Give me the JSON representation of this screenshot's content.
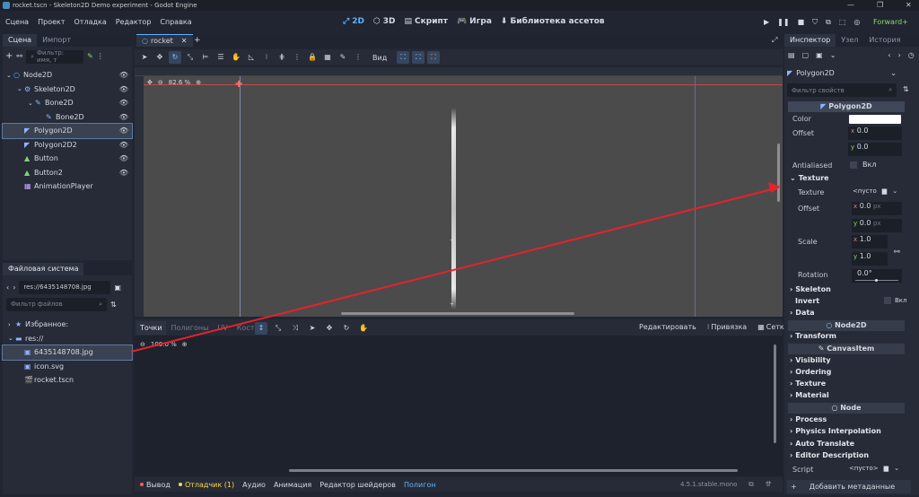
{
  "window": {
    "title": "rocket.tscn - Skeleton2D Demo experiment - Godot Engine",
    "minimize": "—",
    "maximize": "❐",
    "close": "✕"
  },
  "menu": [
    "Сцена",
    "Проект",
    "Отладка",
    "Редактор",
    "Справка"
  ],
  "main_modes": [
    {
      "label": "2D",
      "icon": "⤢"
    },
    {
      "label": "3D",
      "icon": "⬡"
    },
    {
      "label": "Скрипт",
      "icon": "▤"
    },
    {
      "label": "Игра",
      "icon": "🎮"
    },
    {
      "label": "Библиотека ассетов",
      "icon": "⬇"
    }
  ],
  "renderer": "Forward+",
  "scene_dock": {
    "tabs": [
      "Сцена",
      "Импорт"
    ],
    "filter_placeholder": "Фильтр: имя, т",
    "nodes": [
      {
        "label": "Node2D",
        "depth": 0,
        "icon": "○",
        "icon_color": "#5fa3ff",
        "arrow": "⌄"
      },
      {
        "label": "Skeleton2D",
        "depth": 1,
        "icon": "⚙",
        "icon_color": "#8fb5ff",
        "arrow": "⌄"
      },
      {
        "label": "Bone2D",
        "depth": 2,
        "icon": "✎",
        "icon_color": "#8fb5ff",
        "arrow": "⌄"
      },
      {
        "label": "Bone2D",
        "depth": 3,
        "icon": "✎",
        "icon_color": "#8fb5ff",
        "arrow": ""
      },
      {
        "label": "Polygon2D",
        "depth": 1,
        "icon": "◤",
        "icon_color": "#8fb5ff",
        "arrow": "",
        "selected": true
      },
      {
        "label": "Polygon2D2",
        "depth": 1,
        "icon": "◤",
        "icon_color": "#8fb5ff",
        "arrow": ""
      },
      {
        "label": "Button",
        "depth": 1,
        "icon": "▲",
        "icon_color": "#7ed86f",
        "arrow": ""
      },
      {
        "label": "Button2",
        "depth": 1,
        "icon": "▲",
        "icon_color": "#7ed86f",
        "arrow": ""
      },
      {
        "label": "AnimationPlayer",
        "depth": 1,
        "icon": "▦",
        "icon_color": "#c9a6ff",
        "arrow": ""
      }
    ]
  },
  "filesystem": {
    "tab": "Файловая система",
    "path": "res://6435148708.jpg",
    "filter_placeholder": "Фильтр файлов",
    "items": [
      {
        "label": "Избранное:",
        "icon": "★",
        "depth": 0,
        "arrow": "›"
      },
      {
        "label": "res://",
        "icon": "▬",
        "depth": 0,
        "arrow": "⌄"
      },
      {
        "label": "6435148708.jpg",
        "icon": "▣",
        "depth": 1,
        "selected": true
      },
      {
        "label": "icon.svg",
        "icon": "▣",
        "depth": 1
      },
      {
        "label": "rocket.tscn",
        "icon": "🎬",
        "depth": 1
      }
    ]
  },
  "editor_tabs": [
    {
      "label": "rocket",
      "icon": "○"
    }
  ],
  "canvas": {
    "zoom": "82.6 %",
    "view_label": "Вид"
  },
  "polygon_editor": {
    "tabs": [
      "Точки",
      "Полигоны",
      "UV",
      "Кости"
    ],
    "zoom": "100.0 %",
    "actions": [
      "Редактировать",
      "Привязка",
      "Сетка"
    ]
  },
  "bottom_bar": {
    "tabs": [
      {
        "label": "Вывод",
        "dot": "#ff5a5a",
        "color": "#d4d8e0"
      },
      {
        "label": "Отладчик (1)",
        "dot": "#ffd84a",
        "color": "#ffd84a"
      },
      {
        "label": "Аудио",
        "dot": "",
        "color": "#d4d8e0"
      },
      {
        "label": "Анимация",
        "dot": "",
        "color": "#d4d8e0"
      },
      {
        "label": "Редактор шейдеров",
        "dot": "",
        "color": "#d4d8e0"
      },
      {
        "label": "Полигон",
        "dot": "",
        "color": "#5fb2ff"
      }
    ],
    "version": "4.5.1.stable.mono"
  },
  "inspector": {
    "tabs": [
      "Инспектор",
      "Узел",
      "История"
    ],
    "node_name": "Polygon2D",
    "filter_placeholder": "Фильтр свойств",
    "header": "Polygon2D",
    "color_label": "Color",
    "offset_label": "Offset",
    "offset_x": "0.0",
    "offset_y": "0.0",
    "antialiased_label": "Antialiased",
    "antialiased_value": "Вкл",
    "texture_group": "Texture",
    "texture_label": "Texture",
    "texture_value": "<пусто",
    "tex_offset_label": "Offset",
    "tex_offset_x": "0.0",
    "tex_offset_y": "0.0",
    "px": "px",
    "scale_label": "Scale",
    "scale_x": "1.0",
    "scale_y": "1.0",
    "rotation_label": "Rotation",
    "rotation_value": "0.0",
    "rotation_unit": "°",
    "skeleton": "Skeleton",
    "invert_label": "Invert",
    "invert_value": "Вкл",
    "data": "Data",
    "node2d_header": "Node2D",
    "transform": "Transform",
    "canvasitem_header": "CanvasItem",
    "visibility": "Visibility",
    "ordering": "Ordering",
    "texture2": "Texture",
    "material": "Material",
    "node_header": "Node",
    "process": "Process",
    "physics_interp": "Physics Interpolation",
    "auto_translate": "Auto Translate",
    "editor_description": "Editor Description",
    "script_label": "Script",
    "script_value": "<пусто>",
    "add_metadata": "Добавить метаданные"
  },
  "annotation_arrow_color": "#e8212b"
}
